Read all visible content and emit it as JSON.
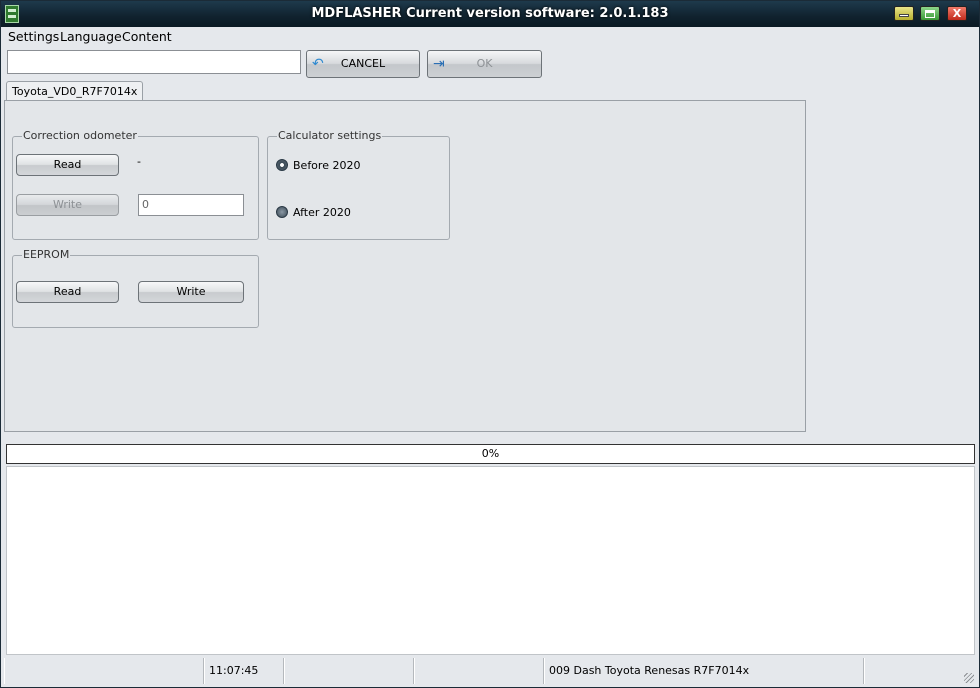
{
  "window": {
    "title": "MDFLASHER  Current version software: 2.0.1.183",
    "close_glyph": "X"
  },
  "menu": {
    "items": [
      "Settings",
      "Language",
      "Content"
    ]
  },
  "toolbar": {
    "input_value": "",
    "cancel_label": "CANCEL",
    "ok_label": "OK",
    "cancel_icon": "undo-arrow-icon",
    "ok_icon": "exit-door-icon"
  },
  "tabs": [
    {
      "label": "Toyota_VD0_R7F7014x",
      "active": true
    }
  ],
  "correction_odometer": {
    "title": "Correction odometer",
    "read_label": "Read",
    "write_label": "Write",
    "value_display": "-",
    "write_input_value": "0"
  },
  "eeprom": {
    "title": "EEPROM",
    "read_label": "Read",
    "write_label": "Write"
  },
  "calculator_settings": {
    "title": "Calculator settings",
    "options": [
      {
        "label": "Before 2020",
        "checked": true
      },
      {
        "label": "After 2020",
        "checked": false
      }
    ]
  },
  "progress": {
    "text": "0%",
    "value": 0
  },
  "statusbar": {
    "time": "11:07:45",
    "device": "009 Dash Toyota Renesas R7F7014x"
  }
}
